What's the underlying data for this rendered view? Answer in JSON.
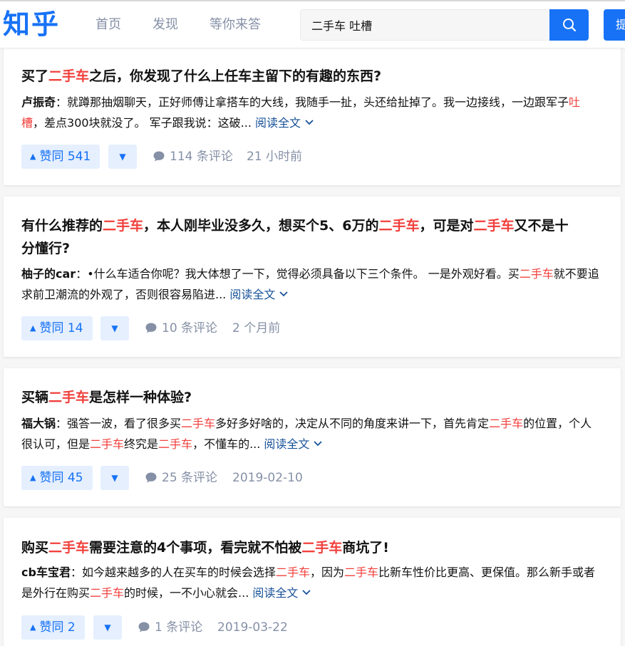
{
  "header": {
    "logo": "知乎",
    "nav": [
      "首页",
      "发现",
      "等你来答"
    ],
    "search_value": "二手车 吐槽",
    "ask_label": "提问"
  },
  "results": [
    {
      "title": [
        {
          "t": "买了"
        },
        {
          "t": "二手车",
          "hl": true
        },
        {
          "t": "之后，你发现了什么上任车主留下的有趣的东西?"
        }
      ],
      "author": "卢振奇",
      "excerpt": [
        {
          "t": "：就蹲那抽烟聊天，正好师傅让拿搭车的大线，我随手一扯，头还给扯掉了。我一边接线，一边跟军子"
        },
        {
          "t": "吐槽",
          "hl": true
        },
        {
          "t": "，差点300块就没了。 军子跟我说：这破... "
        }
      ],
      "read_more": "阅读全文",
      "votes": "赞同 541",
      "comments": "114 条评论",
      "time": "21 小时前"
    },
    {
      "title": [
        {
          "t": "有什么推荐的"
        },
        {
          "t": "二手车",
          "hl": true
        },
        {
          "t": "，本人刚毕业没多久，想买个5、6万的"
        },
        {
          "t": "二手车",
          "hl": true
        },
        {
          "t": "，可是对"
        },
        {
          "t": "二手车",
          "hl": true
        },
        {
          "t": "又不是十"
        }
      ],
      "title_line2": "分懂行?",
      "author": "柚子的car",
      "excerpt": [
        {
          "t": "：•什么车适合你呢？我大体想了一下，觉得必须具备以下三个条件。 一是外观好看。买"
        },
        {
          "t": "二手车",
          "hl": true
        },
        {
          "t": "就不要追求前卫潮流的外观了，否则很容易陷进... "
        }
      ],
      "read_more": "阅读全文",
      "votes": "赞同 14",
      "comments": "10 条评论",
      "time": "2 个月前"
    },
    {
      "title": [
        {
          "t": "买辆"
        },
        {
          "t": "二手车",
          "hl": true
        },
        {
          "t": "是怎样一种体验?"
        }
      ],
      "author": "福大锅",
      "excerpt": [
        {
          "t": "：强答一波，看了很多买"
        },
        {
          "t": "二手车",
          "hl": true
        },
        {
          "t": "多好多好啥的，决定从不同的角度来讲一下，首先肯定"
        },
        {
          "t": "二手车",
          "hl": true
        },
        {
          "t": "的位置，个人很认可，但是"
        },
        {
          "t": "二手车",
          "hl": true
        },
        {
          "t": "终究是"
        },
        {
          "t": "二手车",
          "hl": true
        },
        {
          "t": "，不懂车的... "
        }
      ],
      "read_more": "阅读全文",
      "votes": "赞同 45",
      "comments": "25 条评论",
      "time": "2019-02-10"
    },
    {
      "title": [
        {
          "t": "购买"
        },
        {
          "t": "二手车",
          "hl": true
        },
        {
          "t": "需要注意的4个事项，看完就不怕被"
        },
        {
          "t": "二手车",
          "hl": true
        },
        {
          "t": "商坑了!"
        }
      ],
      "author": "cb车宝君",
      "excerpt": [
        {
          "t": "：如今越来越多的人在买车的时候会选择"
        },
        {
          "t": "二手车",
          "hl": true
        },
        {
          "t": "，因为"
        },
        {
          "t": "二手车",
          "hl": true
        },
        {
          "t": "比新车性价比更高、更保值。那么新手或者是外行在购买"
        },
        {
          "t": "二手车",
          "hl": true
        },
        {
          "t": "的时候，一不小心就会... "
        }
      ],
      "read_more": "阅读全文",
      "votes": "赞同 2",
      "comments": "1 条评论",
      "time": "2019-03-22"
    }
  ],
  "colors": {
    "brand": "#1772f6",
    "highlight": "#f1403c",
    "link": "#175199",
    "muted": "#8590a6",
    "vote_bg": "#e5effe"
  }
}
